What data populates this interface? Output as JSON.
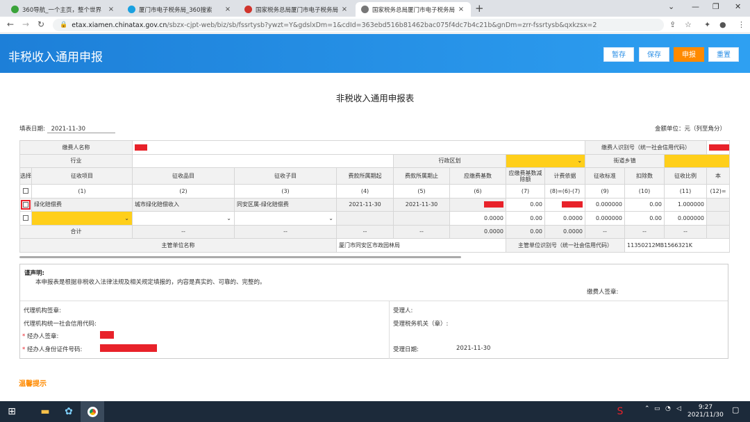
{
  "browser": {
    "tabs": [
      {
        "title": "360导航_一个主页，整个世界",
        "close": "×",
        "fav_color": "#3aa33a"
      },
      {
        "title": "厦门市电子税务局_360搜索",
        "close": "×",
        "fav_color": "#19a0e0"
      },
      {
        "title": "国家税务总局厦门市电子税务局",
        "close": "×",
        "fav_color": "#d0342c"
      },
      {
        "title": "国家税务总局厦门市电子税务局",
        "close": "×",
        "fav_color": "#777777"
      }
    ],
    "new_tab": "+",
    "url_host": "etax.xiamen.chinatax.gov.cn",
    "url_path": "/sbzx-cjpt-web/biz/sb/fssrtysb?ywzt=Y&gdslxDm=1&cdId=363ebd516b81462bac075f4dc7b4c21b&gnDm=zrr-fssrtysb&qxkzsx=2"
  },
  "app": {
    "title": "非税收入通用申报",
    "buttons": {
      "draft": "暂存",
      "save": "保存",
      "submit": "申报",
      "reset": "重置"
    },
    "accent": "#ff8a00"
  },
  "form": {
    "title": "非税收入通用申报表",
    "fill_date_label": "填表日期:",
    "fill_date": "2021-11-30",
    "unit": "金额单位：元（列至角分）",
    "payer_name_label": "缴费人名称",
    "payer_id_label": "缴费人识别号（统一社会信用代码）",
    "industry_label": "行业",
    "region_label": "行政区划",
    "street_label": "街道乡镇",
    "headers": [
      "选择",
      "征收项目",
      "征收品目",
      "征收子目",
      "费款所属期起",
      "费款所属期止",
      "应缴费基数",
      "应缴费基数减除额",
      "计费依据",
      "征收标准",
      "扣除数",
      "征收比例",
      "本"
    ],
    "col_numbers": [
      "(1)",
      "(2)",
      "(3)",
      "(4)",
      "(5)",
      "(6)",
      "(7)",
      "(8)=(6)-(7)",
      "(9)",
      "(10)",
      "(11)",
      "(12)="
    ],
    "row1": {
      "item": "绿化赔偿费",
      "category": "城市绿化赔偿收入",
      "sub": "同安区属-绿化赔偿费",
      "start": "2021-11-30",
      "end": "2021-11-30",
      "deduct": "0.00",
      "standard": "0.000000",
      "discount": "0.00",
      "ratio": "1.000000"
    },
    "row2": {
      "base": "0.0000",
      "deduct": "0.00",
      "basis": "0.0000",
      "standard": "0.000000",
      "discount": "0.00",
      "ratio": "0.000000"
    },
    "total": {
      "label": "合计",
      "dash": "--",
      "base": "0.0000",
      "deduct": "0.00",
      "basis": "0.0000"
    },
    "authority_label": "主管单位名称",
    "authority_name": "厦门市同安区市政园林局",
    "authority_id_label": "主管单位识别号（统一社会信用代码）",
    "authority_id": "11350212MB1566321K"
  },
  "declaration": {
    "title": "谨声明:",
    "text": "本申报表是根据非税收入法律法规及相关规定填报的，内容是真实的、可靠的、完整的。",
    "payer_sign": "缴费人签章:",
    "agency_sign": "代理机构签章:",
    "agency_code": "代理机构统一社会信用代码:",
    "handler_sign": "经办人签章:",
    "handler_id": "经办人身份证件号码:",
    "receiver": "受理人:",
    "receive_office": "受理税务机关（章）:",
    "receive_date_label": "受理日期:",
    "receive_date": "2021-11-30",
    "required_mark": "*"
  },
  "hint": "温馨提示",
  "taskbar": {
    "time": "9:27",
    "date": "2021/11/30"
  }
}
